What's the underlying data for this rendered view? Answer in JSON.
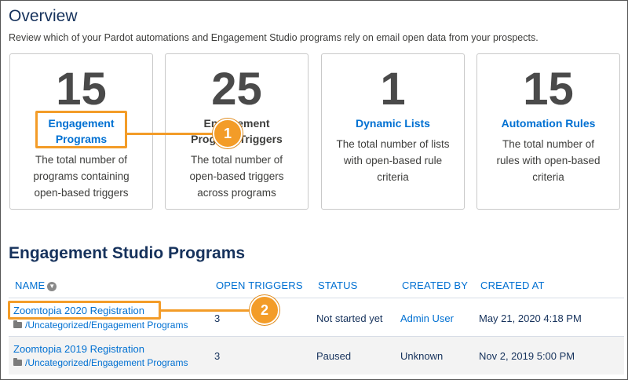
{
  "overview": {
    "title": "Overview",
    "subtitle": "Review which of your Pardot automations and Engagement Studio programs rely on email open data from your prospects."
  },
  "cards": [
    {
      "number": "15",
      "title": "Engagement Programs",
      "desc": "The total number of programs containing open-based triggers"
    },
    {
      "number": "25",
      "title": "Engagement Program Triggers",
      "desc": "The total number of open-based triggers across programs"
    },
    {
      "number": "1",
      "title": "Dynamic Lists",
      "desc": "The total number of lists with open-based rule criteria"
    },
    {
      "number": "15",
      "title": "Automation Rules",
      "desc": "The total number of rules with open-based criteria"
    }
  ],
  "callouts": [
    "1",
    "2"
  ],
  "programs": {
    "title": "Engagement Studio Programs",
    "columns": [
      "NAME",
      "OPEN TRIGGERS",
      "STATUS",
      "CREATED BY",
      "CREATED AT"
    ],
    "rows": [
      {
        "name": "Zoomtopia 2020 Registration",
        "path": "/Uncategorized/Engagement Programs",
        "triggers": "3",
        "status": "Not started yet",
        "created_by": "Admin User",
        "created_at": "May 21, 2020 4:18 PM"
      },
      {
        "name": "Zoomtopia 2019 Registration",
        "path": "/Uncategorized/Engagement Programs",
        "triggers": "3",
        "status": "Paused",
        "created_by": "Unknown",
        "created_at": "Nov 2, 2019 5:00 PM"
      }
    ]
  },
  "colors": {
    "link": "#0070d2",
    "accent": "#f39c28",
    "heading": "#16325c"
  },
  "icons": {
    "sort": "sort-circle-icon",
    "folder": "folder-icon"
  }
}
